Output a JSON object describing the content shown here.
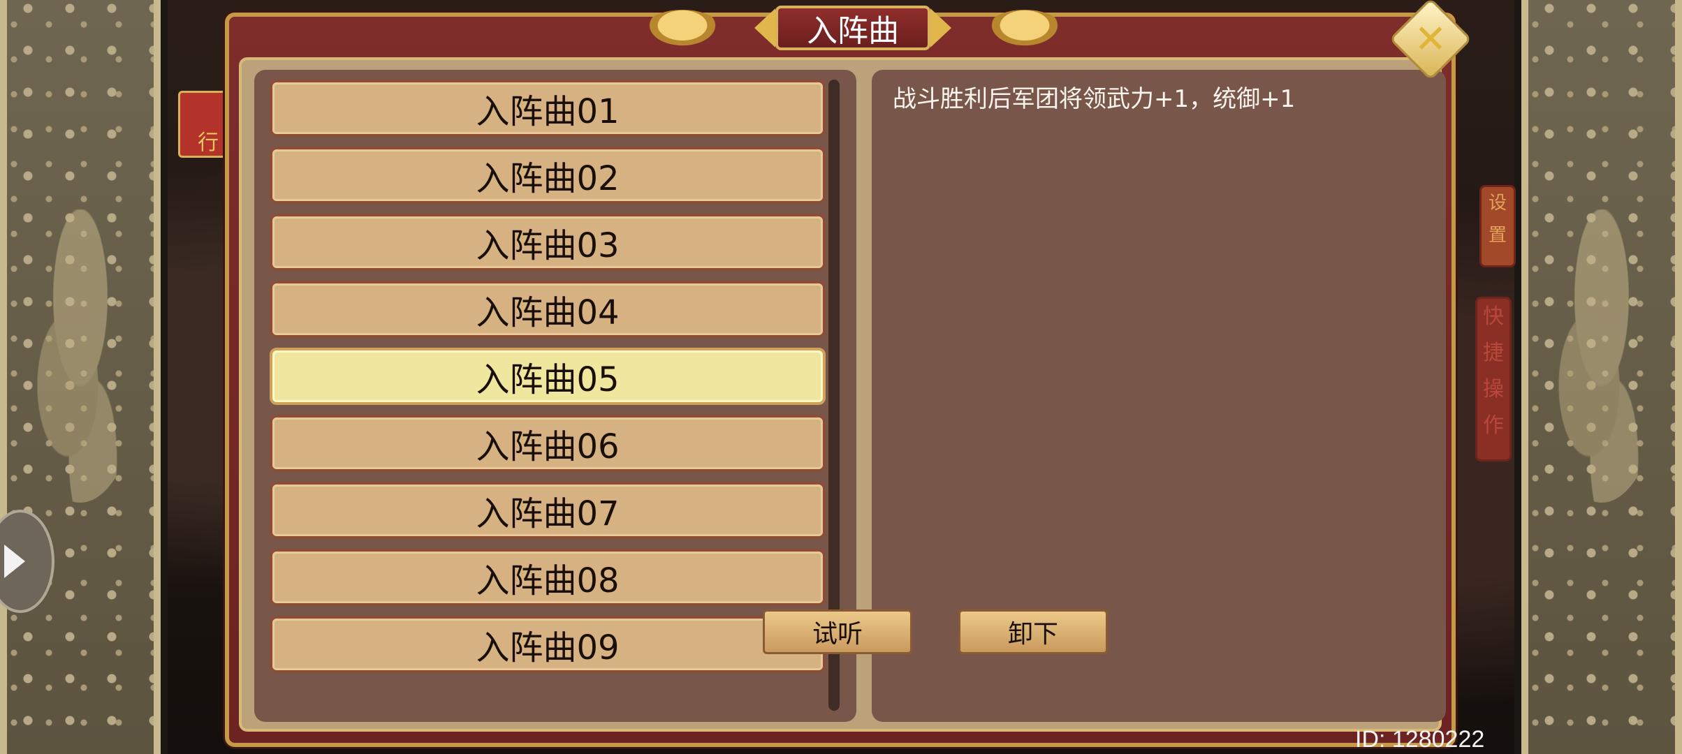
{
  "dialog": {
    "title": "入阵曲"
  },
  "songs": [
    {
      "label": "入阵曲01",
      "selected": false
    },
    {
      "label": "入阵曲02",
      "selected": false
    },
    {
      "label": "入阵曲03",
      "selected": false
    },
    {
      "label": "入阵曲04",
      "selected": false
    },
    {
      "label": "入阵曲05",
      "selected": true
    },
    {
      "label": "入阵曲06",
      "selected": false
    },
    {
      "label": "入阵曲07",
      "selected": false
    },
    {
      "label": "入阵曲08",
      "selected": false
    },
    {
      "label": "入阵曲09",
      "selected": false
    }
  ],
  "description": "战斗胜利后军团将领武力+1，统御+1",
  "buttons": {
    "listen": "试听",
    "unload": "卸下"
  },
  "sidebar": {
    "settings": "设置",
    "quick_action": "快捷操作"
  },
  "scene": {
    "red_sign": "行"
  },
  "footer": {
    "id_text": "ID: 1280222"
  },
  "icons": {
    "close": "close-icon",
    "expand": "arrow-right-icon"
  },
  "colors": {
    "item_normal": "#d6b182",
    "item_selected": "#f0e79e",
    "panel": "#78574a",
    "dialog_frame": "#7e2d2b"
  }
}
